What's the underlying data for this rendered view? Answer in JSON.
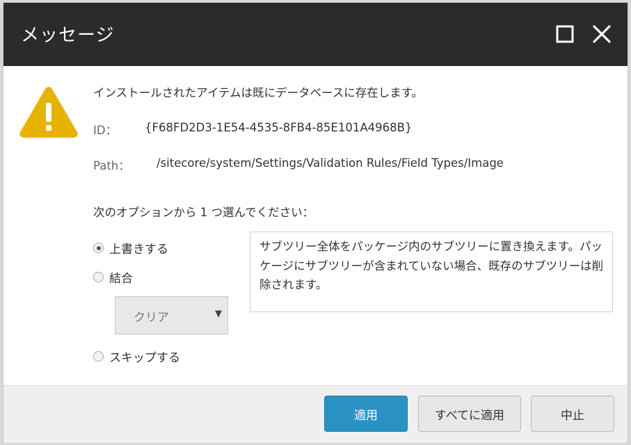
{
  "dialog": {
    "title": "メッセージ",
    "maximize_icon": "maximize-icon",
    "close_icon": "close-icon",
    "warning_icon": "warning-icon",
    "warning_color": "#e7b300"
  },
  "message": {
    "main": "インストールされたアイテムは既にデータベースに存在します。",
    "id_label": "ID：",
    "id_value": "{F68FD2D3-1E54-4535-8FB4-85E101A4968B}",
    "path_label": "Path：",
    "path_value": "/sitecore/system/Settings/Validation Rules/Field Types/Image",
    "prompt": "次のオプションから 1 つ選んでください："
  },
  "options": [
    {
      "label": "上書きする",
      "checked": true
    },
    {
      "label": "結合",
      "checked": false
    },
    {
      "label": "スキップする",
      "checked": false
    }
  ],
  "merge_select": {
    "value": "クリア"
  },
  "description": "サブツリー全体をパッケージ内のサブツリーに置き換えます。パッケージにサブツリーが含まれていない場合、既存のサブツリーは削除されます。",
  "buttons": {
    "apply": "適用",
    "apply_all": "すべてに適用",
    "cancel": "中止"
  },
  "colors": {
    "titlebar": "#2b2b2b",
    "primary_button": "#2b93c4"
  }
}
